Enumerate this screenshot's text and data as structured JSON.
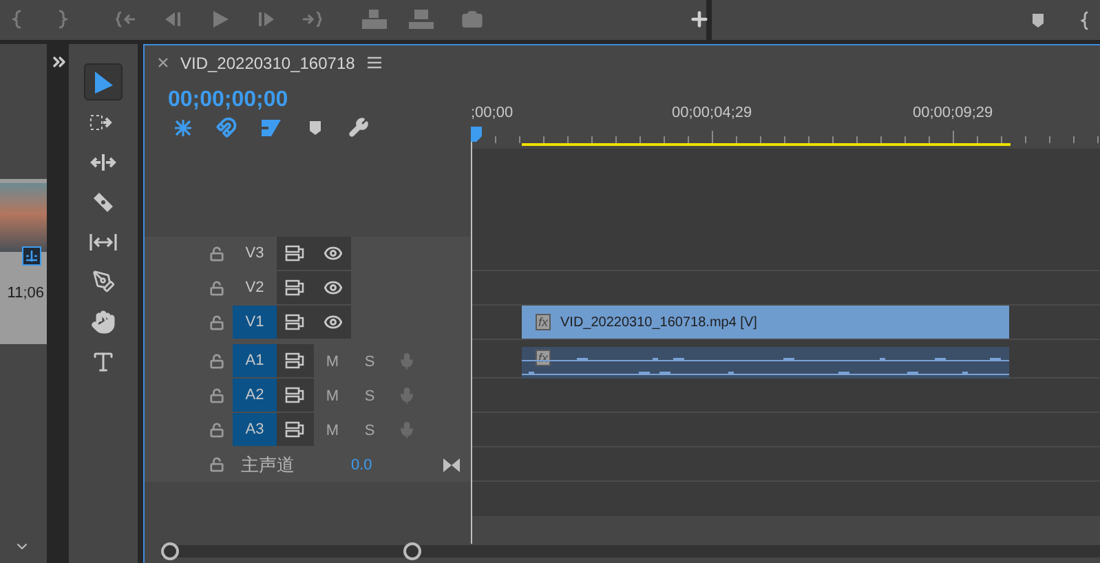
{
  "program_monitor": {
    "controls": [
      {
        "kind": "mark-in"
      },
      {
        "kind": "mark-out"
      },
      {
        "kind": "go-in"
      },
      {
        "kind": "step-back"
      },
      {
        "kind": "play"
      },
      {
        "kind": "step-forward"
      },
      {
        "kind": "go-out"
      },
      {
        "kind": "lift"
      },
      {
        "kind": "extract"
      },
      {
        "kind": "camera"
      }
    ]
  },
  "project_panel": {
    "duration": "11;06"
  },
  "tools": [
    {
      "kind": "selection",
      "selected": true
    },
    {
      "kind": "track-select",
      "selected": false
    },
    {
      "kind": "ripple",
      "selected": false
    },
    {
      "kind": "razor",
      "selected": false
    },
    {
      "kind": "slip",
      "selected": false
    },
    {
      "kind": "pen",
      "selected": false
    },
    {
      "kind": "hand",
      "selected": false
    },
    {
      "kind": "type",
      "selected": false
    }
  ],
  "timeline": {
    "title": "VID_20220310_160718",
    "timecode": "00;00;00;00",
    "timeline_tools": [
      {
        "kind": "nest",
        "on": true
      },
      {
        "kind": "snap",
        "on": true
      },
      {
        "kind": "linked",
        "on": true
      },
      {
        "kind": "marker",
        "on": false
      },
      {
        "kind": "settings",
        "on": false
      }
    ],
    "ruler_labels": [
      ";00;00",
      "00;00;04;29",
      "00;00;09;29"
    ],
    "tracks": [
      {
        "kind": "video",
        "name": "V3",
        "selected": false
      },
      {
        "kind": "video",
        "name": "V2",
        "selected": false
      },
      {
        "kind": "video",
        "name": "V1",
        "selected": true,
        "clip": {
          "label": "VID_20220310_160718.mp4 [V]",
          "fx": "fx"
        }
      },
      {
        "kind": "audio",
        "name": "A1",
        "selected": true,
        "mute": "M",
        "solo": "S",
        "clip": {
          "fx": "fx"
        }
      },
      {
        "kind": "audio",
        "name": "A2",
        "selected": true,
        "mute": "M",
        "solo": "S"
      },
      {
        "kind": "audio",
        "name": "A3",
        "selected": true,
        "mute": "M",
        "solo": "S"
      }
    ],
    "master": {
      "name": "主声道",
      "value": "0.0"
    }
  }
}
